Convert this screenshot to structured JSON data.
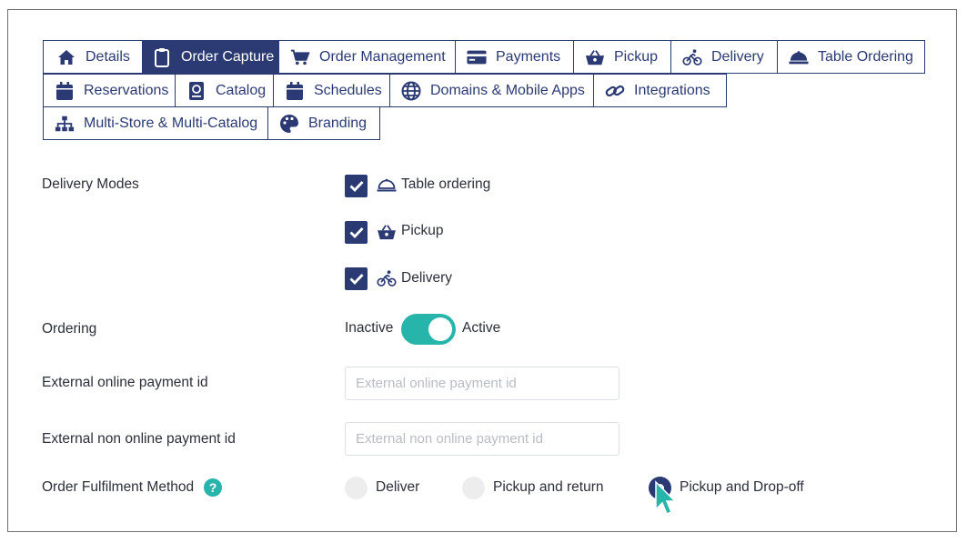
{
  "tabs": [
    {
      "label": "Details",
      "icon": "home-icon",
      "active": false
    },
    {
      "label": "Order Capture",
      "icon": "clipboard-icon",
      "active": true
    },
    {
      "label": "Order Management",
      "icon": "cart-icon",
      "active": false
    },
    {
      "label": "Payments",
      "icon": "credit-card-icon",
      "active": false
    },
    {
      "label": "Pickup",
      "icon": "basket-icon",
      "active": false
    },
    {
      "label": "Delivery",
      "icon": "bicycle-icon",
      "active": false
    },
    {
      "label": "Table Ordering",
      "icon": "cloche-icon",
      "active": false
    },
    {
      "label": "Reservations",
      "icon": "calendar-icon",
      "active": false
    },
    {
      "label": "Catalog",
      "icon": "book-icon",
      "active": false
    },
    {
      "label": "Schedules",
      "icon": "calendar-icon",
      "active": false
    },
    {
      "label": "Domains & Mobile Apps",
      "icon": "globe-icon",
      "active": false
    },
    {
      "label": "Integrations",
      "icon": "link-icon",
      "active": false
    },
    {
      "label": "Multi-Store & Multi-Catalog",
      "icon": "sitemap-icon",
      "active": false
    },
    {
      "label": "Branding",
      "icon": "palette-icon",
      "active": false
    }
  ],
  "form": {
    "delivery_modes": {
      "label": "Delivery Modes",
      "options": [
        {
          "label": "Table ordering",
          "icon": "cloche-icon",
          "checked": true
        },
        {
          "label": "Pickup",
          "icon": "basket-icon",
          "checked": true
        },
        {
          "label": "Delivery",
          "icon": "bicycle-icon",
          "checked": true
        }
      ]
    },
    "ordering": {
      "label": "Ordering",
      "off_label": "Inactive",
      "on_label": "Active",
      "value": true
    },
    "external_online_payment": {
      "label": "External online payment id",
      "value": "",
      "placeholder": "External online payment id"
    },
    "external_non_online_payment": {
      "label": "External non online payment id",
      "value": "",
      "placeholder": "External non online payment id"
    },
    "fulfilment": {
      "label": "Order Fulfilment Method",
      "help": "?",
      "options": [
        {
          "label": "Deliver",
          "selected": false
        },
        {
          "label": "Pickup and return",
          "selected": false
        },
        {
          "label": "Pickup and Drop-off",
          "selected": true
        }
      ]
    }
  },
  "colors": {
    "primary": "#2b3a73",
    "accent": "#27b4aa",
    "radio_off": "#ededed"
  }
}
